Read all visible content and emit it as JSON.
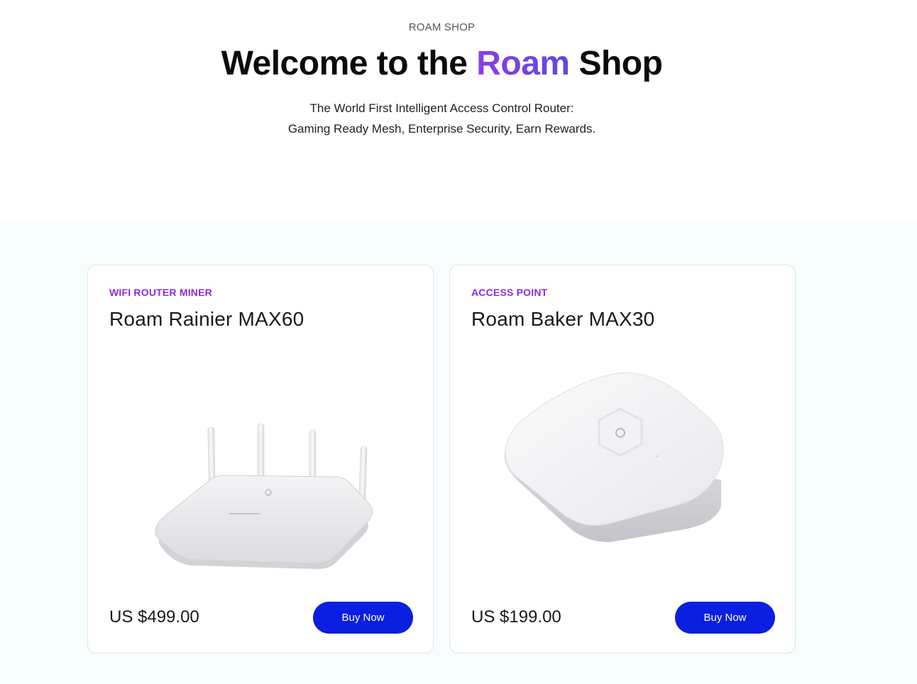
{
  "header": {
    "eyebrow": "ROAM SHOP",
    "title_before": "Welcome to the ",
    "title_accent": "Roam",
    "title_after": " Shop",
    "subtitle_line1": "The World First Intelligent Access Control Router:",
    "subtitle_line2": "Gaming Ready Mesh, Enterprise Security, Earn Rewards."
  },
  "products": [
    {
      "category": "WIFI ROUTER MINER",
      "name": "Roam Rainier MAX60",
      "price": "US $499.00",
      "button_label": "Buy Now",
      "image_icon": "wifi-router-icon"
    },
    {
      "category": "ACCESS POINT",
      "name": "Roam Baker MAX30",
      "price": "US $199.00",
      "button_label": "Buy Now",
      "image_icon": "access-point-icon"
    }
  ],
  "colors": {
    "accent_purple": "#8a2be2",
    "button_blue": "#0a1fe0",
    "section_bg": "#f7fdfd"
  }
}
